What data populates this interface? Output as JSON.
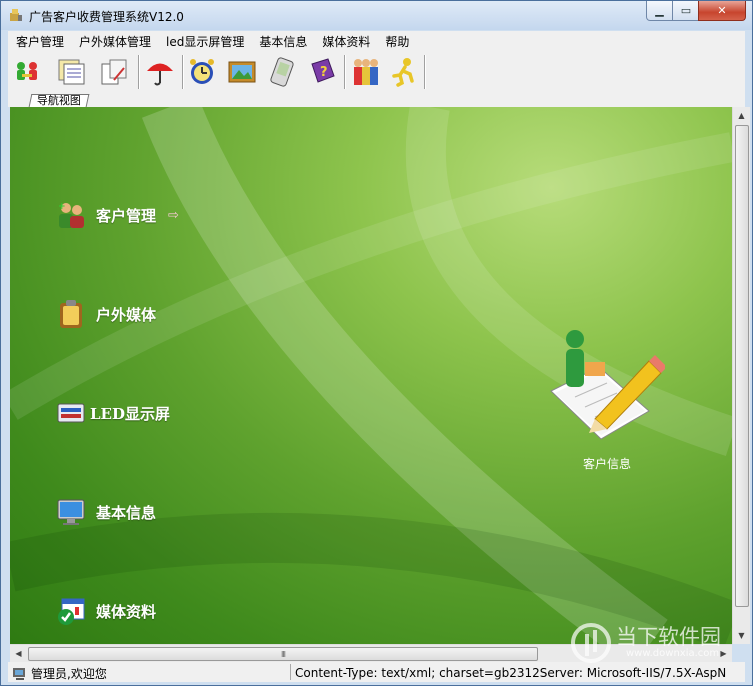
{
  "window": {
    "title": "广告客户收费管理系统V12.0"
  },
  "menu": [
    "客户管理",
    "户外媒体管理",
    "led显示屏管理",
    "基本信息",
    "媒体资料",
    "帮助"
  ],
  "toolbar": [
    "users-icon",
    "documents-icon",
    "edit-documents-icon",
    "umbrella-icon",
    "alarm-clock-icon",
    "picture-icon",
    "pda-icon",
    "help-book-icon",
    "group-icon",
    "exit-runner-icon"
  ],
  "tab": {
    "label": "导航视图"
  },
  "nav": [
    {
      "label": "客户管理",
      "icon": "customer-icon"
    },
    {
      "label": "户外媒体",
      "icon": "clipboard-icon"
    },
    {
      "label": "LED显示屏",
      "icon": "led-icon"
    },
    {
      "label": "基本信息",
      "icon": "monitor-icon"
    },
    {
      "label": "媒体资料",
      "icon": "media-check-icon"
    }
  ],
  "feature": {
    "label": "客户信息",
    "icon": "customer-info-icon"
  },
  "scroll": {
    "hthumb_grip": "III"
  },
  "status": {
    "user": "管理员,欢迎您",
    "info": "Content-Type: text/xml; charset=gb2312Server: Microsoft-IIS/7.5X-AspN"
  },
  "watermark": {
    "text": "当下软件园",
    "url": "www.downxia.com"
  },
  "colors": {
    "background": "#5fa22e",
    "titlebar": "#c4d7ee",
    "close": "#c7452e"
  }
}
